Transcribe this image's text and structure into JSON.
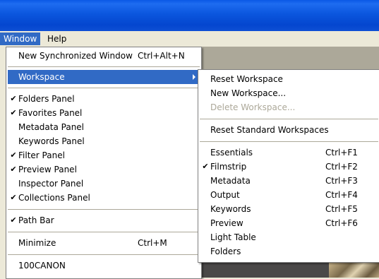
{
  "menubar": {
    "window_label": "Window",
    "help_label": "Help"
  },
  "window_menu": {
    "new_sync_window": {
      "label": "New Synchronized Window",
      "shortcut": "Ctrl+Alt+N"
    },
    "workspace": {
      "label": "Workspace"
    },
    "folders_panel": {
      "label": "Folders Panel",
      "check": "✔"
    },
    "favorites_panel": {
      "label": "Favorites Panel",
      "check": "✔"
    },
    "metadata_panel": {
      "label": "Metadata Panel"
    },
    "keywords_panel": {
      "label": "Keywords Panel"
    },
    "filter_panel": {
      "label": "Filter Panel",
      "check": "✔"
    },
    "preview_panel": {
      "label": "Preview Panel",
      "check": "✔"
    },
    "inspector_panel": {
      "label": "Inspector Panel"
    },
    "collections_panel": {
      "label": "Collections Panel",
      "check": "✔"
    },
    "path_bar": {
      "label": "Path Bar",
      "check": "✔"
    },
    "minimize": {
      "label": "Minimize",
      "shortcut": "Ctrl+M"
    },
    "recent_100canon": {
      "label": "100CANON"
    }
  },
  "workspace_menu": {
    "reset_workspace": {
      "label": "Reset Workspace"
    },
    "new_workspace": {
      "label": "New Workspace..."
    },
    "delete_workspace": {
      "label": "Delete Workspace..."
    },
    "reset_standard": {
      "label": "Reset Standard Workspaces"
    },
    "essentials": {
      "label": "Essentials",
      "shortcut": "Ctrl+F1"
    },
    "filmstrip": {
      "label": "Filmstrip",
      "shortcut": "Ctrl+F2",
      "check": "✔"
    },
    "metadata": {
      "label": "Metadata",
      "shortcut": "Ctrl+F3"
    },
    "output": {
      "label": "Output",
      "shortcut": "Ctrl+F4"
    },
    "keywords": {
      "label": "Keywords",
      "shortcut": "Ctrl+F5"
    },
    "preview": {
      "label": "Preview",
      "shortcut": "Ctrl+F6"
    },
    "light_table": {
      "label": "Light Table"
    },
    "folders": {
      "label": "Folders"
    }
  },
  "colors": {
    "titlebar": "#0b56de",
    "menu_highlight": "#316ac5",
    "menu_background": "#ffffff",
    "disabled_text": "#aca899",
    "menubar_background": "#ece9d8"
  }
}
